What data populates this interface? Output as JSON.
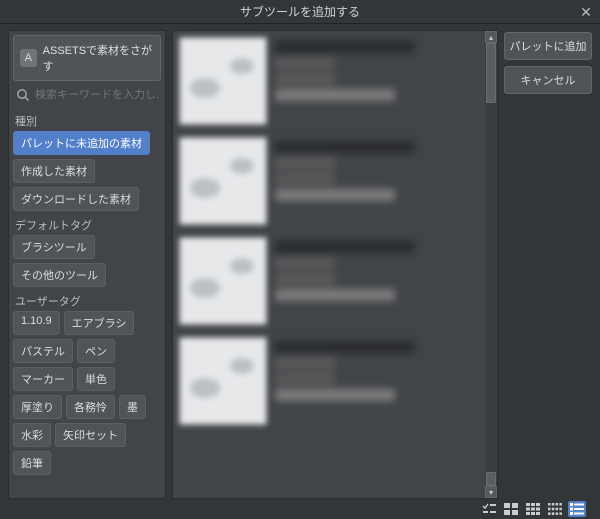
{
  "title": "サブツールを追加する",
  "sidebar": {
    "assets_button": "ASSETSで素材をさがす",
    "assets_icon": "A",
    "search_placeholder": "検索キーワードを入力し...",
    "groups": [
      {
        "label": "種別",
        "chips": [
          {
            "label": "パレットに未追加の素材",
            "active": true
          },
          {
            "label": "作成した素材",
            "active": false
          },
          {
            "label": "ダウンロードした素材",
            "active": false
          }
        ]
      },
      {
        "label": "デフォルトタグ",
        "chips": [
          {
            "label": "ブラシツール",
            "active": false
          },
          {
            "label": "その他のツール",
            "active": false
          }
        ]
      },
      {
        "label": "ユーザータグ",
        "chips": [
          {
            "label": "1.10.9",
            "active": false
          },
          {
            "label": "エアブラシ",
            "active": false
          },
          {
            "label": "パステル",
            "active": false
          },
          {
            "label": "ペン",
            "active": false
          },
          {
            "label": "マーカー",
            "active": false
          },
          {
            "label": "単色",
            "active": false
          },
          {
            "label": "厚塗り",
            "active": false
          },
          {
            "label": "各務怜",
            "active": false
          },
          {
            "label": "墨",
            "active": false
          },
          {
            "label": "水彩",
            "active": false
          },
          {
            "label": "矢印セット",
            "active": false
          },
          {
            "label": "鉛筆",
            "active": false
          }
        ]
      }
    ]
  },
  "right": {
    "add_label": "パレットに追加",
    "cancel_label": "キャンセル"
  },
  "list_count": 4,
  "view_active_index": 4
}
